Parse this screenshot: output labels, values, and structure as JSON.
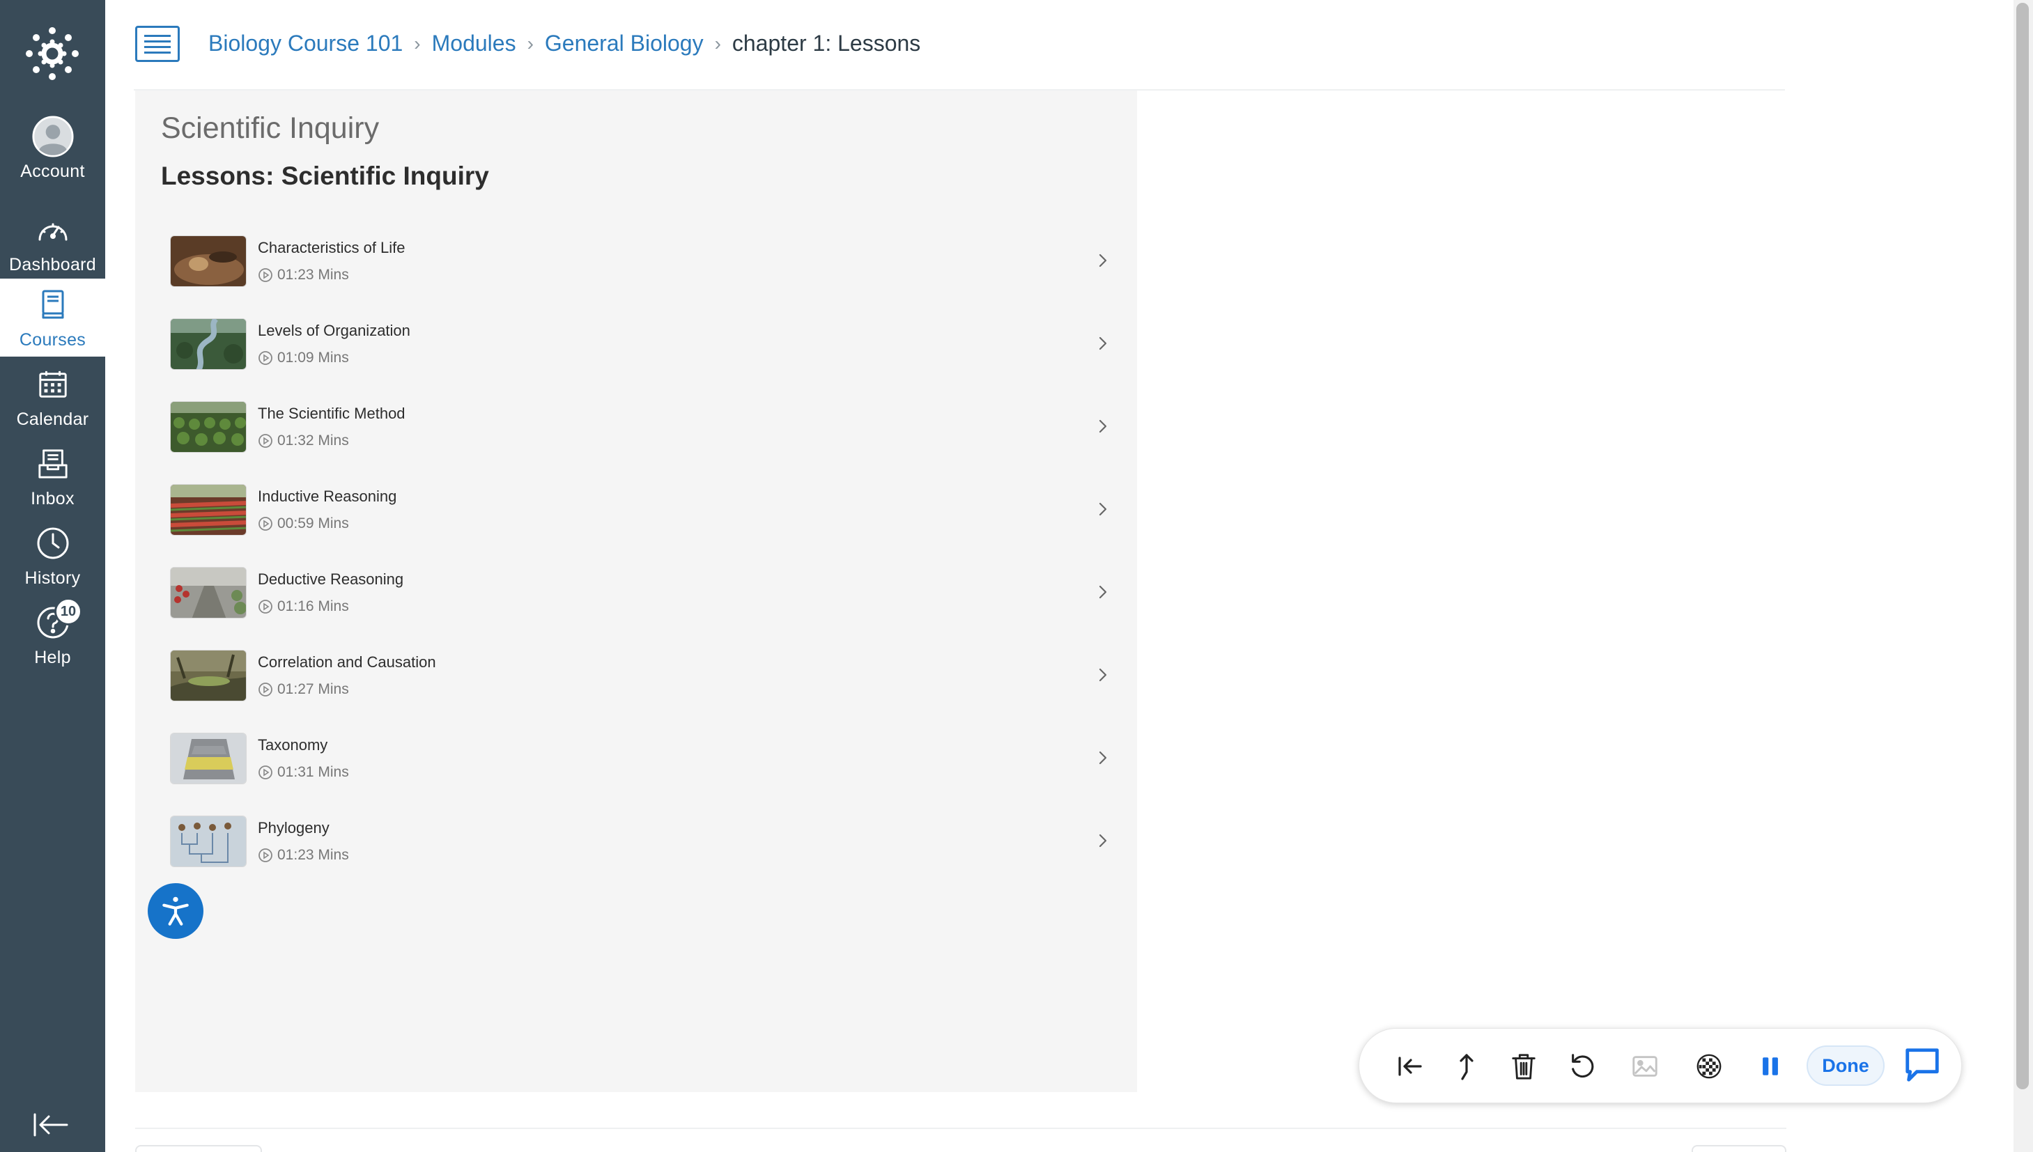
{
  "global_nav": {
    "items": [
      {
        "label": "Account",
        "icon": "account-avatar-icon"
      },
      {
        "label": "Dashboard",
        "icon": "dashboard-gauge-icon"
      },
      {
        "label": "Courses",
        "icon": "courses-book-icon",
        "active": true
      },
      {
        "label": "Calendar",
        "icon": "calendar-icon"
      },
      {
        "label": "Inbox",
        "icon": "inbox-icon"
      },
      {
        "label": "History",
        "icon": "history-clock-icon"
      },
      {
        "label": "Help",
        "icon": "help-question-icon",
        "badge": "10"
      }
    ]
  },
  "breadcrumb": {
    "items": [
      "Biology Course 101",
      "Modules",
      "General Biology"
    ],
    "current": "chapter 1: Lessons"
  },
  "page": {
    "title": "Scientific Inquiry",
    "subtitle": "Lessons: Scientific Inquiry"
  },
  "lessons": [
    {
      "title": "Characteristics of Life",
      "duration": "01:23 Mins"
    },
    {
      "title": "Levels of Organization",
      "duration": "01:09 Mins"
    },
    {
      "title": "The Scientific Method",
      "duration": "01:32 Mins"
    },
    {
      "title": "Inductive Reasoning",
      "duration": "00:59 Mins"
    },
    {
      "title": "Deductive Reasoning",
      "duration": "01:16 Mins"
    },
    {
      "title": "Correlation and Causation",
      "duration": "01:27 Mins"
    },
    {
      "title": "Taxonomy",
      "duration": "01:31 Mins"
    },
    {
      "title": "Phylogeny",
      "duration": "01:23 Mins"
    }
  ],
  "recording_toolbar": {
    "done_label": "Done"
  },
  "colors": {
    "nav_bg": "#394b58",
    "link_blue": "#2b7abc",
    "panel_bg": "#f5f5f5",
    "accessibility_blue": "#1673c9",
    "toolbar_blue": "#1a73e8"
  }
}
